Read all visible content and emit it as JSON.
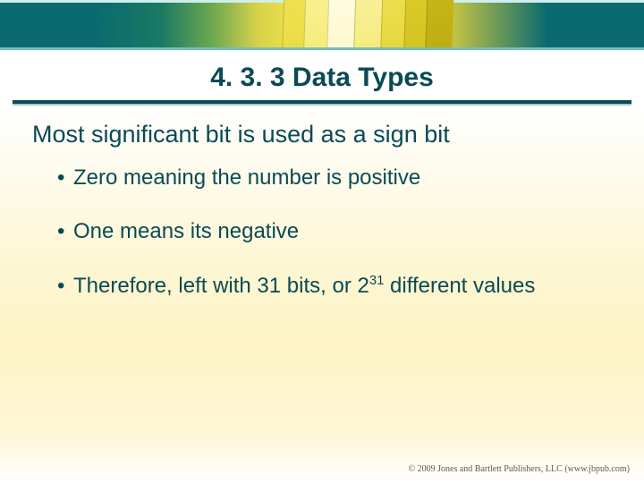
{
  "title": "4. 3. 3 Data Types",
  "lead": "Most significant bit is used as a sign bit",
  "bullets": [
    {
      "text": "Zero meaning the number is positive"
    },
    {
      "text": "One means its negative"
    },
    {
      "prefix": "Therefore, left with 31 bits, or 2",
      "sup": "31",
      "suffix": " different values"
    }
  ],
  "footer": "© 2009 Jones and Bartlett Publishers, LLC (www.jbpub.com)"
}
